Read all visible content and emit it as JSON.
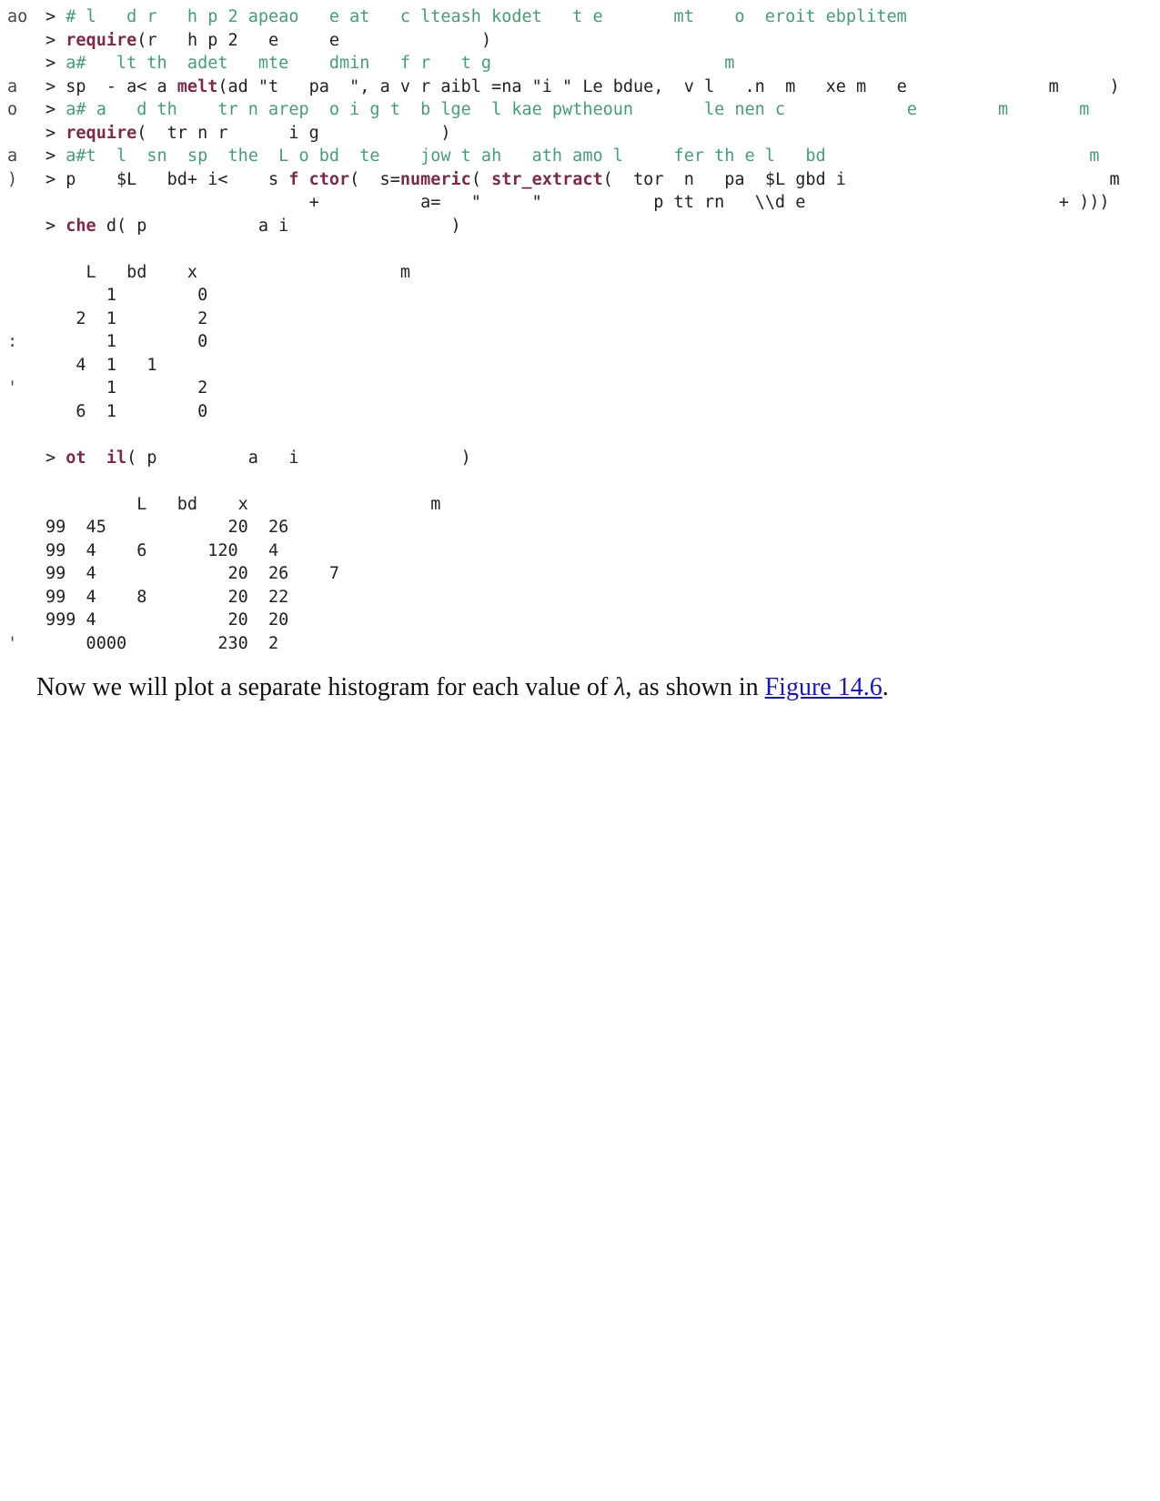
{
  "code_lines": [
    {
      "n": "ao",
      "text": "> # l   d r   h p 2 apeao   e at   c lteash kodet   t e       mt    o  eroit ebplitem",
      "cls": "cmt"
    },
    {
      "n": "",
      "text": "> require(r   h p 2   e     e              )",
      "cls": "kwline"
    },
    {
      "n": "",
      "text": "> a#   lt th  adet   mte    dmin   f r   t g                       m",
      "cls": "cmt"
    },
    {
      "n": "a",
      "text": "> sp  - a< a melt(ad \"t   pa  \", a v r aibl =na \"i \" Le bdue,  v l   .n  m   xe m   e              m     )",
      "cls": "mix"
    },
    {
      "n": "o",
      "text": "> a# a   d th    tr n arep  o i g t  b lge  l kae pwtheoun       le nen c            e        m       m",
      "cls": "cmt"
    },
    {
      "n": "",
      "text": "> require(  tr n r      i g            )",
      "cls": "kwline"
    },
    {
      "n": "a",
      "text": "> a#t  l  sn  sp  the  L o bd  te    jow t ah   ath amo l     fer th e l   bd                          m",
      "cls": "cmt"
    },
    {
      "n": ")",
      "text": "> p    $L   bd+ i<    s f ctor(  s=numeric( str_extract(  tor  n   pa  $L gbd i                          m",
      "cls": "mix"
    },
    {
      "n": "",
      "text": "                          +          a=   \"     \"           p tt rn   \\\\d e                         + )))",
      "cls": "plain"
    },
    {
      "n": "",
      "text": "> che d( p           a i                )",
      "cls": "kwline"
    },
    {
      "n": "",
      "text": "",
      "cls": "blank"
    },
    {
      "n": "",
      "text": "    L   bd    x                    m",
      "cls": "out"
    },
    {
      "n": "",
      "text": "      1        0",
      "cls": "out"
    },
    {
      "n": "",
      "text": "   2  1        2",
      "cls": "out"
    },
    {
      "n": ":",
      "text": "      1        0",
      "cls": "out"
    },
    {
      "n": "",
      "text": "   4  1   1",
      "cls": "out"
    },
    {
      "n": "'",
      "text": "      1        2",
      "cls": "out"
    },
    {
      "n": "",
      "text": "   6  1        0",
      "cls": "out"
    },
    {
      "n": "",
      "text": "",
      "cls": "blank"
    },
    {
      "n": "",
      "text": "> ot  il( p         a   i                )",
      "cls": "kwline"
    },
    {
      "n": "",
      "text": "",
      "cls": "blank"
    },
    {
      "n": "",
      "text": "         L   bd    x                  m",
      "cls": "out"
    },
    {
      "n": "",
      "text": "99  45            20  26",
      "cls": "out"
    },
    {
      "n": "",
      "text": "99  4    6      120   4",
      "cls": "out"
    },
    {
      "n": "",
      "text": "99  4             20  26    7",
      "cls": "out"
    },
    {
      "n": "",
      "text": "99  4    8        20  22",
      "cls": "out"
    },
    {
      "n": "",
      "text": "999 4             20  20",
      "cls": "out"
    },
    {
      "n": "'",
      "text": "    0000         230  2",
      "cls": "out"
    }
  ],
  "prose": {
    "before": "Now we will plot a separate histogram for each value of ",
    "symbol": "λ",
    "middle": ", as shown in ",
    "link": "Figure 14.6",
    "after": "."
  }
}
